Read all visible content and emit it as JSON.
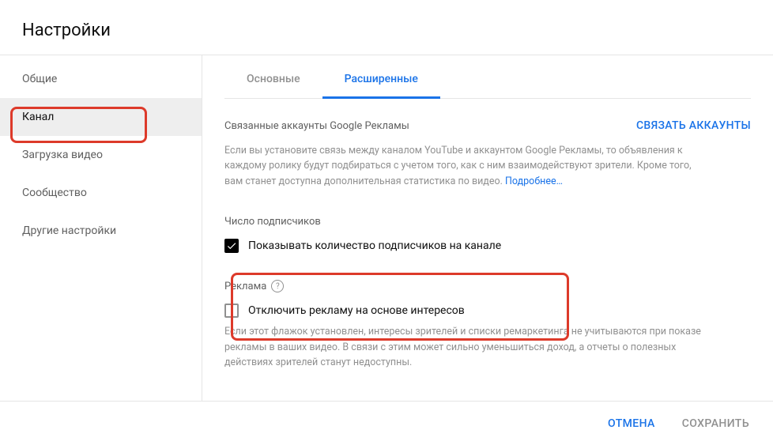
{
  "page_title": "Настройки",
  "sidebar": {
    "items": [
      {
        "label": "Общие"
      },
      {
        "label": "Канал"
      },
      {
        "label": "Загрузка видео"
      },
      {
        "label": "Сообщество"
      },
      {
        "label": "Другие настройки"
      }
    ],
    "active_index": 1
  },
  "tabs": {
    "items": [
      {
        "label": "Основные"
      },
      {
        "label": "Расширенные"
      }
    ],
    "active_index": 1
  },
  "linked_accounts": {
    "title": "Связанные аккаунты Google Рекламы",
    "link_button": "СВЯЗАТЬ АККАУНТЫ",
    "desc": "Если вы установите связь между каналом YouTube и аккаунтом Google Рекламы, то объявления к каждому ролику будут подбираться с учетом того, как с ним взаимодействуют зрители. Кроме того, вам станет доступна дополнительная статистика по видео. ",
    "learn_more": "Подробнее…"
  },
  "subscribers": {
    "title": "Число подписчиков",
    "checkbox_label": "Показывать количество подписчиков на канале",
    "checked": true
  },
  "ads": {
    "title": "Реклама",
    "checkbox_label": "Отключить рекламу на основе интересов",
    "checked": false,
    "desc": "Если этот флажок установлен, интересы зрителей и списки ремаркетинга не учитываются при показе рекламы в ваших видео. В связи с этим может сильно уменьшиться доход, а отчеты о полезных действиях зрителей станут недоступны."
  },
  "footer": {
    "cancel": "ОТМЕНА",
    "save": "СОХРАНИТЬ"
  }
}
